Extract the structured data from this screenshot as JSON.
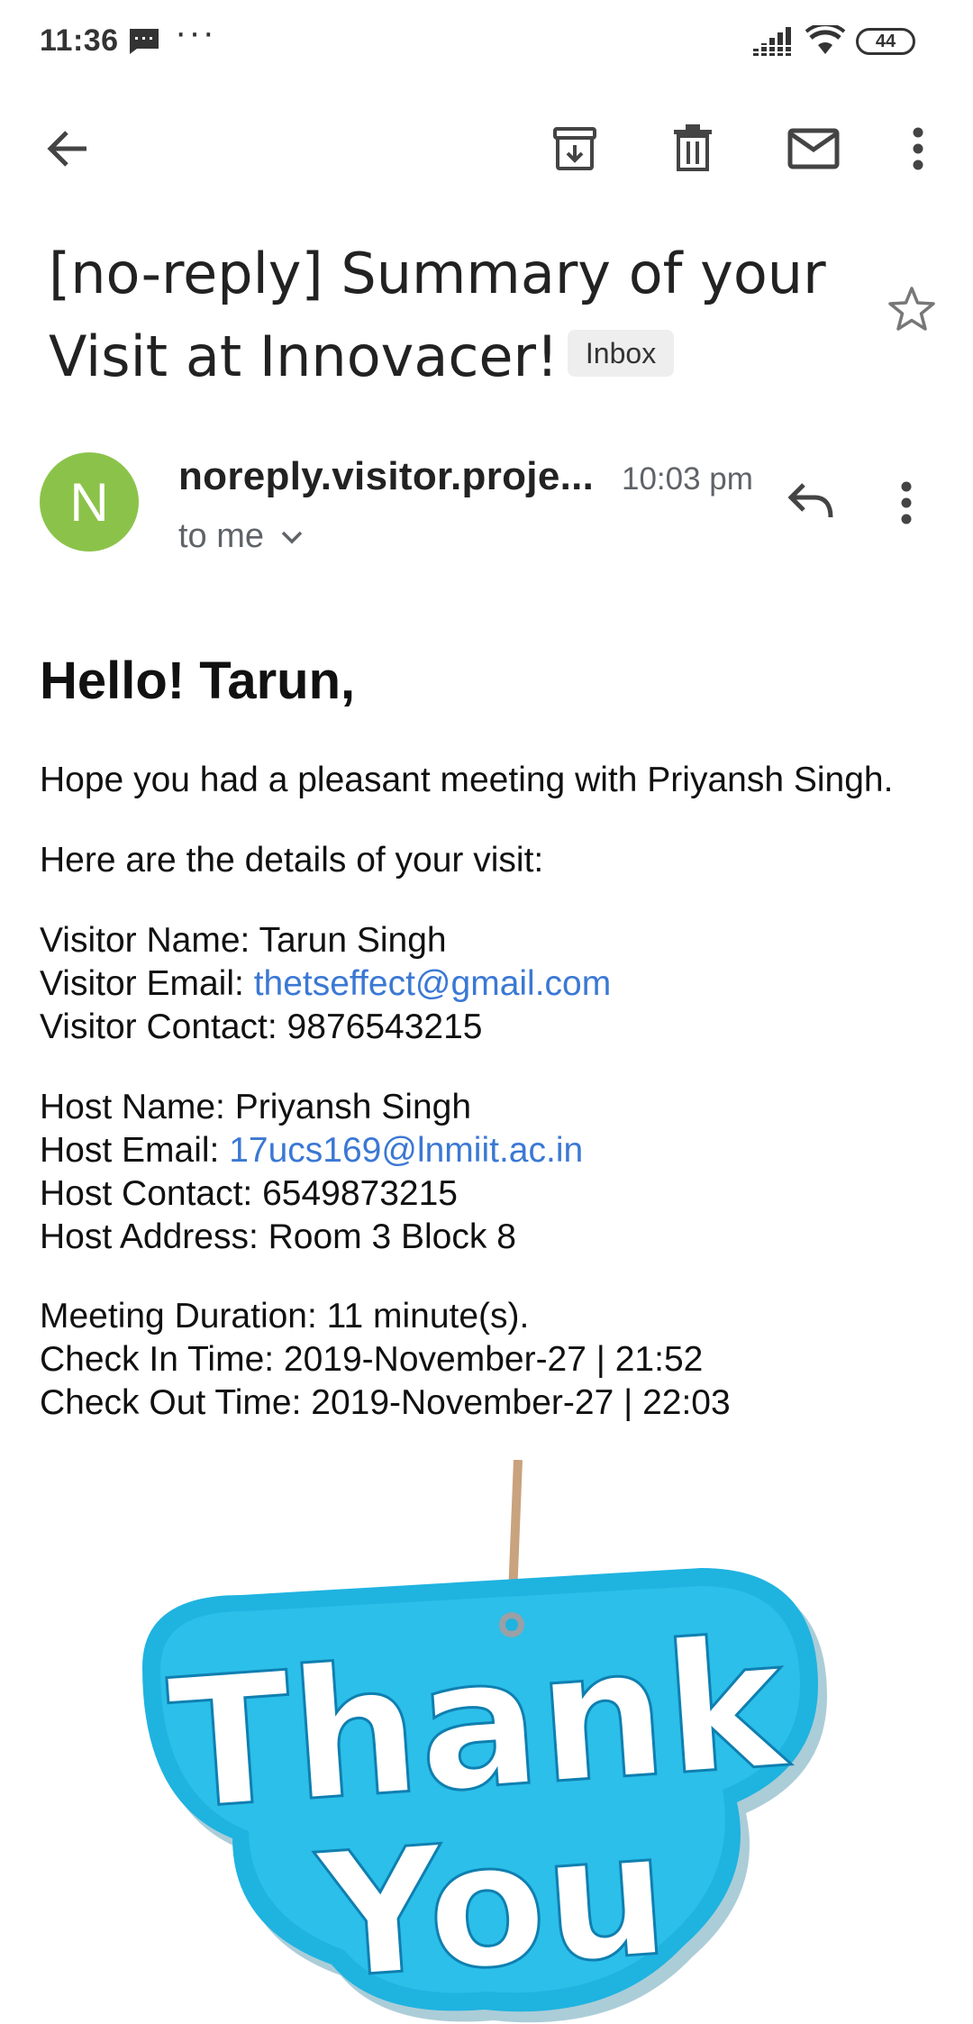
{
  "status_bar": {
    "time": "11:36",
    "dots": "···",
    "battery": "44"
  },
  "subject": {
    "text": "[no-reply] Summary of your Visit at Innovacer!",
    "label": "Inbox"
  },
  "sender": {
    "initial": "N",
    "name": "noreply.visitor.proje...",
    "time": "10:03 pm",
    "to": "to me"
  },
  "body": {
    "greeting": "Hello! Tarun,",
    "intro": "Hope you had a pleasant meeting with Priyansh Singh.",
    "details_heading": "Here are the details of your visit:",
    "visitor": {
      "name_line": "Visitor Name: Tarun Singh",
      "email_label": "Visitor Email: ",
      "email": "thetseffect@gmail.com",
      "contact_line": "Visitor Contact: 9876543215"
    },
    "host": {
      "name_line": "Host Name: Priyansh Singh",
      "email_label": "Host Email: ",
      "email": "17ucs169@lnmiit.ac.in",
      "contact_line": "Host Contact: 6549873215",
      "address_line": "Host Address: Room 3 Block 8"
    },
    "meeting": {
      "duration_line": "Meeting Duration: 11 minute(s).",
      "checkin_line": "Check In Time: 2019-November-27 | 21:52",
      "checkout_line": "Check Out Time: 2019-November-27 | 22:03"
    },
    "image_text": {
      "line1": "Thank",
      "line2": "You"
    }
  },
  "colors": {
    "avatar": "#8bc34a",
    "link": "#3b78d4",
    "sticker_blue": "#1fb3e0"
  }
}
